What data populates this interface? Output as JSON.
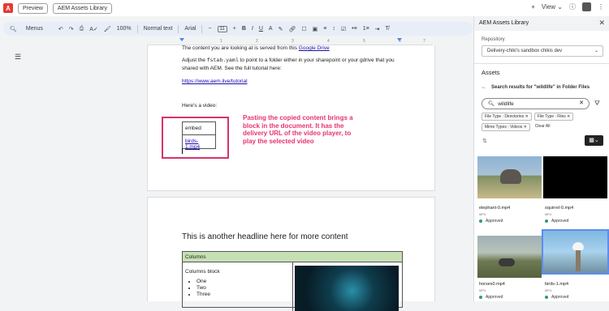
{
  "topbar": {
    "logo_letter": "A",
    "preview_label": "Preview",
    "app_label": "AEM Assets Library",
    "plus": "+",
    "view_label": "View ⌄",
    "info": "ⓘ",
    "more": "⋮"
  },
  "docbar": {
    "search_label": "Menus",
    "zoom": "100%",
    "style": "Normal text",
    "font": "Arial",
    "font_size": "11",
    "minus": "−",
    "plus": "+"
  },
  "ruler": [
    "1",
    "2",
    "3",
    "4",
    "5",
    "6",
    "7"
  ],
  "doc": {
    "line1_prefix": "The content you are looking at is served from this ",
    "line1_link": "Google Drive",
    "line2_a": "Adjust the ",
    "line2_code": "fstab.yaml",
    "line2_b": " to point to a folder either in your sharepoint or your gdrive that you",
    "line3": "shared with AEM. See the full tutorial here:",
    "tutorial_link": "https://www.aem.live/tutorial",
    "video_intro": "Here's a video:",
    "embed_header": "embed",
    "embed_link": "birds-1.mp4",
    "annotation": "Pasting the copied content brings a block in the document. It has the delivery URL of the video player, to play the selected video",
    "headline": "This is another headline here for more content",
    "columns_title": "Columns",
    "columns_block": "Columns block",
    "columns_list": [
      "One",
      "Two",
      "Three"
    ]
  },
  "panel": {
    "title": "AEM Assets Library",
    "repository_label": "Repository",
    "repository_value": "Delivery-chiki's sandbox chikis dev",
    "assets_title": "Assets",
    "search_results": "Search results for \"wildlife\" in Folder Files",
    "search_value": "wildlife",
    "tags": [
      "File Type : Directories ✕",
      "File Type : Files ✕",
      "Mime Types : Videos ✕"
    ],
    "clear_all": "Clear All",
    "assets": [
      {
        "name": "elephant-0.mp4",
        "type": "MP4",
        "status": "Approved"
      },
      {
        "name": "squirrel-0.mp4",
        "type": "MP4",
        "status": "Approved"
      },
      {
        "name": "horses0.mp4",
        "type": "MP4",
        "status": "Approved"
      },
      {
        "name": "birds-1.mp4",
        "type": "MP4",
        "status": "Approved"
      }
    ]
  },
  "colors": {
    "annotation": "#e8336d",
    "approved": "#2e9d6b",
    "selection": "#5b8def"
  }
}
